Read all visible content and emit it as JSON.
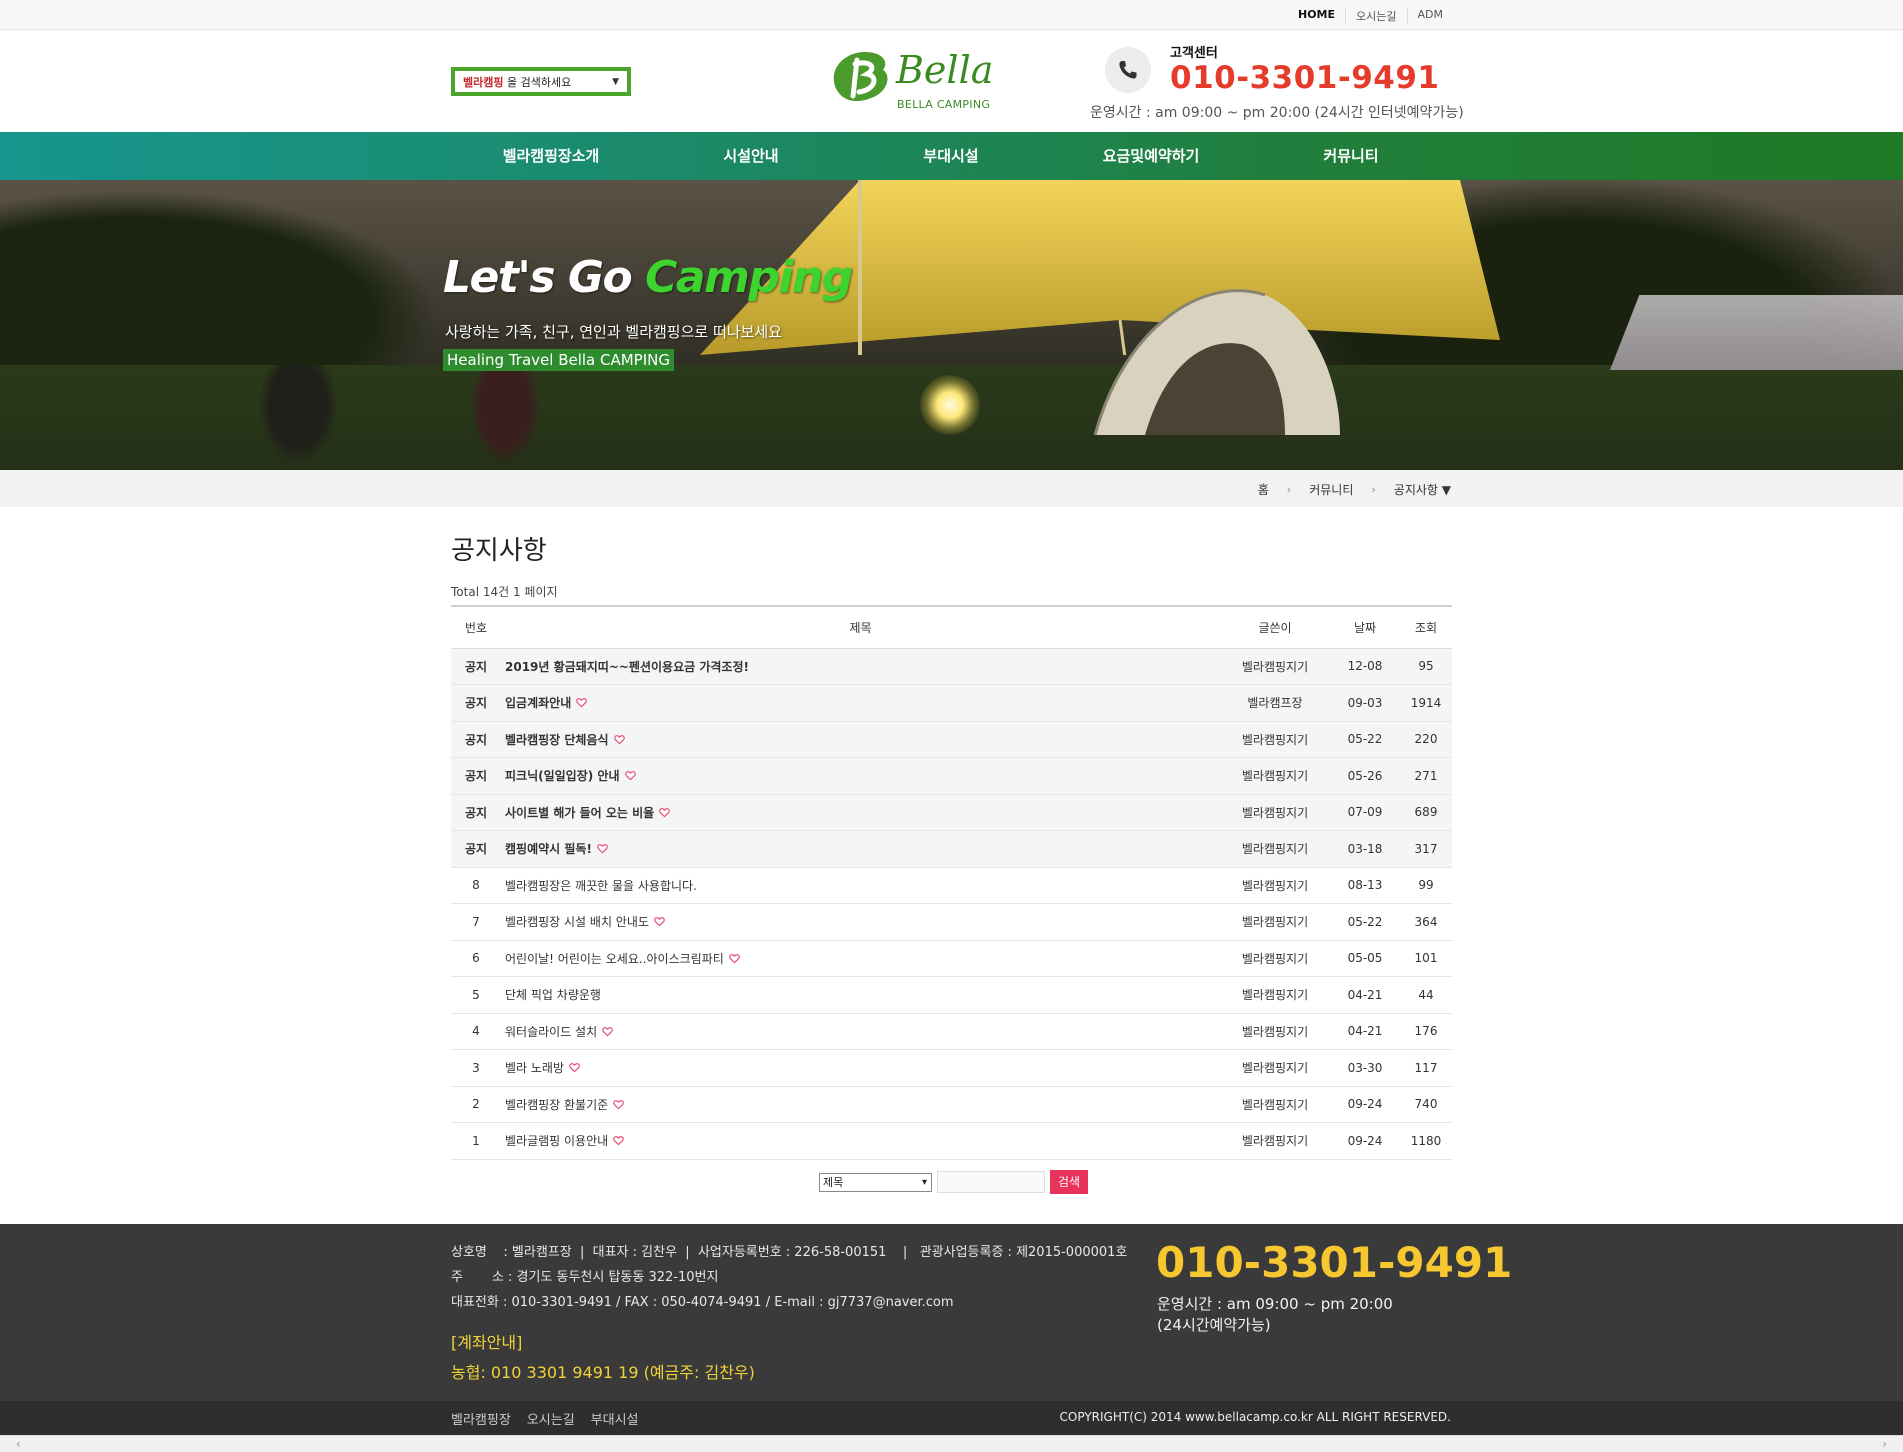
{
  "topbar": {
    "links": [
      "HOME",
      "오시는길",
      "ADM"
    ]
  },
  "header": {
    "search_brand": "벨라캠핑",
    "search_suffix": " 을 검색하세요",
    "logo_text": "Bella",
    "logo_sub": "BELLA CAMPING",
    "cs_label": "고객센터",
    "cs_phone": "010-3301-9491",
    "cs_hours": "운영시간 : am 09:00 ~ pm 20:00 (24시간 인터넷예약가능)",
    "phone_icon": "phone-icon"
  },
  "nav": {
    "items": [
      "벨라캠핑장소개",
      "시설안내",
      "부대시설",
      "요금및예약하기",
      "커뮤니티"
    ]
  },
  "banner": {
    "title_a": "Let's Go ",
    "title_b": "Camping",
    "tagline": "사랑하는 가족, 친구, 연인과 벨라캠핑으로 떠나보세요",
    "tag_box": "Healing Travel Bella CAMPING"
  },
  "breadcrumb": {
    "home": "홈",
    "level1": "커뮤니티",
    "level2": "공지사항 ▼"
  },
  "board": {
    "title": "공지사항",
    "total": "Total 14건 1 페이지",
    "headers": {
      "num": "번호",
      "title": "제목",
      "writer": "글쓴이",
      "date": "날짜",
      "hits": "조회"
    },
    "rows": [
      {
        "num": "공지",
        "title": "2019년 황금돼지띠~~펜션이용요금 가격조정!",
        "heart": false,
        "writer": "벨라캠핑지기",
        "date": "12-08",
        "hits": "95",
        "notice": true
      },
      {
        "num": "공지",
        "title": "입금계좌안내",
        "heart": true,
        "writer": "벨라캠프장",
        "date": "09-03",
        "hits": "1914",
        "notice": true
      },
      {
        "num": "공지",
        "title": "벨라캠핑장 단체음식",
        "heart": true,
        "writer": "벨라캠핑지기",
        "date": "05-22",
        "hits": "220",
        "notice": true
      },
      {
        "num": "공지",
        "title": "피크닉(일일입장) 안내",
        "heart": true,
        "writer": "벨라캠핑지기",
        "date": "05-26",
        "hits": "271",
        "notice": true
      },
      {
        "num": "공지",
        "title": "사이트별 해가 들어 오는 비율",
        "heart": true,
        "writer": "벨라캠핑지기",
        "date": "07-09",
        "hits": "689",
        "notice": true
      },
      {
        "num": "공지",
        "title": "캠핑예약시 필독!",
        "heart": true,
        "writer": "벨라캠핑지기",
        "date": "03-18",
        "hits": "317",
        "notice": true
      },
      {
        "num": "8",
        "title": "벨라캠핑장은 깨끗한 물을 사용합니다.",
        "heart": false,
        "writer": "벨라캠핑지기",
        "date": "08-13",
        "hits": "99",
        "notice": false
      },
      {
        "num": "7",
        "title": "벨라캠핑장 시설 배치 안내도",
        "heart": true,
        "writer": "벨라캠핑지기",
        "date": "05-22",
        "hits": "364",
        "notice": false
      },
      {
        "num": "6",
        "title": "어린이날! 어린이는 오세요..아이스크림파티",
        "heart": true,
        "writer": "벨라캠핑지기",
        "date": "05-05",
        "hits": "101",
        "notice": false
      },
      {
        "num": "5",
        "title": "단체 픽업 차량운행",
        "heart": false,
        "writer": "벨라캠핑지기",
        "date": "04-21",
        "hits": "44",
        "notice": false
      },
      {
        "num": "4",
        "title": "워터슬라이드 설치",
        "heart": true,
        "writer": "벨라캠핑지기",
        "date": "04-21",
        "hits": "176",
        "notice": false
      },
      {
        "num": "3",
        "title": "벨라 노래방",
        "heart": true,
        "writer": "벨라캠핑지기",
        "date": "03-30",
        "hits": "117",
        "notice": false
      },
      {
        "num": "2",
        "title": "벨라캠핑장 환불기준",
        "heart": true,
        "writer": "벨라캠핑지기",
        "date": "09-24",
        "hits": "740",
        "notice": false
      },
      {
        "num": "1",
        "title": "벨라글램핑 이용안내",
        "heart": true,
        "writer": "벨라캠핑지기",
        "date": "09-24",
        "hits": "1180",
        "notice": false
      }
    ]
  },
  "search": {
    "select_value": "제목",
    "button": "검색"
  },
  "footer": {
    "line1": "상호명    : 벨라캠프장  |  대표자 : 김찬우  |  사업자등록번호 : 226-58-00151    |   관광사업등록증 : 제2015-000001호",
    "line2": "주       소 : 경기도 동두천시 탑동동 322-10번지",
    "line3": "대표전화 : 010-3301-9491 / FAX : 050-4074-9491 / E-mail : gj7737@naver.com",
    "acct_label": "[계좌안내]",
    "acct_value": "농협: 010 3301 9491 19 (예금주: 김찬우)",
    "phone": "010-3301-9491",
    "hours1": "운영시간 : am 09:00 ~ pm 20:00",
    "hours2": "(24시간예약가능)"
  },
  "bottom": {
    "links": [
      "벨라캠핑장",
      "오시는길",
      "부대시설"
    ],
    "copyright": "COPYRIGHT(C) 2014 www.bellacamp.co.kr ALL RIGHT RESERVED."
  },
  "colors": {
    "brand_green": "#3b8b22",
    "phone_red": "#e53b2b",
    "footer_yellow": "#f7c730",
    "search_btn": "#e8345a"
  }
}
